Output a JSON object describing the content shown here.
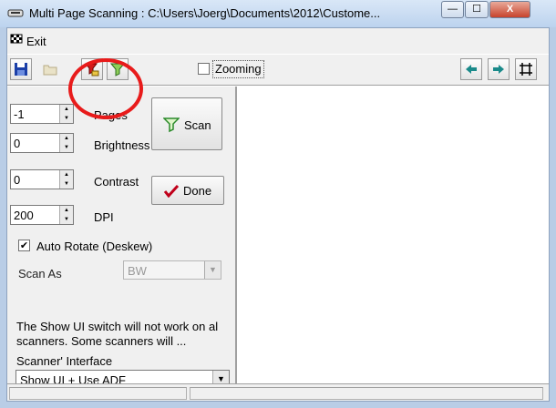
{
  "window": {
    "title": "Multi Page Scanning  : C:\\Users\\Joerg\\Documents\\2012\\Custome...",
    "min_glyph": "—",
    "max_glyph": "☐",
    "close_glyph": "X"
  },
  "menu": {
    "exit_label": "Exit"
  },
  "toolbar": {
    "zooming_label": "Zooming",
    "zooming_checked": false
  },
  "settings": {
    "pages": {
      "value": "-1",
      "label": "Pages"
    },
    "brightness": {
      "value": "0",
      "label": "Brightness"
    },
    "contrast": {
      "value": "0",
      "label": "Contrast"
    },
    "dpi": {
      "value": "200",
      "label": "DPI"
    },
    "auto_rotate": {
      "label": "Auto Rotate (Deskew)",
      "checked": true,
      "mark": "✔"
    },
    "scan_as": {
      "label": "Scan As",
      "value": "BW"
    },
    "note": "The Show UI switch will not work on al scanners. Some scanners will ...",
    "interface": {
      "label": "Scanner' Interface",
      "value": "Show UI + Use ADF"
    }
  },
  "buttons": {
    "scan_label": "Scan",
    "done_label": "Done"
  },
  "colors": {
    "highlight_circle": "#e81b1b",
    "done_check": "#c0001a",
    "scan_icon": "#2a8a2a",
    "nav_arrow": "#1a8a8a"
  }
}
